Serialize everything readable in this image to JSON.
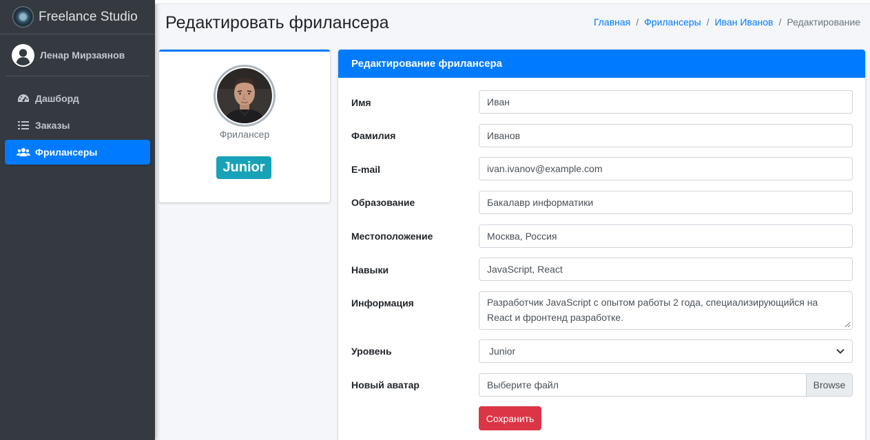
{
  "app": {
    "brand": "Freelance Studio",
    "user_name": "Ленар Мирзаянов"
  },
  "sidebar": {
    "items": [
      {
        "label": "Дашборд",
        "icon": "tachometer-icon",
        "active": false
      },
      {
        "label": "Заказы",
        "icon": "list-icon",
        "active": false
      },
      {
        "label": "Фрилансеры",
        "icon": "users-icon",
        "active": true
      }
    ]
  },
  "header": {
    "title": "Редактировать фрилансера",
    "breadcrumb": [
      "Главная",
      "Фрилансеры",
      "Иван Иванов",
      "Редактирование"
    ]
  },
  "profile": {
    "role": "Фрилансер",
    "level_badge": "Junior"
  },
  "form": {
    "title": "Редактирование фрилансера",
    "fields": {
      "first_name": {
        "label": "Имя",
        "value": "Иван"
      },
      "last_name": {
        "label": "Фамилия",
        "value": "Иванов"
      },
      "email": {
        "label": "E-mail",
        "value": "ivan.ivanov@example.com"
      },
      "education": {
        "label": "Образование",
        "value": "Бакалавр информатики"
      },
      "location": {
        "label": "Местоположение",
        "value": "Москва, Россия"
      },
      "skills": {
        "label": "Навыки",
        "value": "JavaScript, React"
      },
      "info": {
        "label": "Информация",
        "value": "Разработчик JavaScript с опытом работы 2 года, специализирующийся на React и фронтенд разработке."
      },
      "level": {
        "label": "Уровень",
        "value": "Junior"
      },
      "avatar": {
        "label": "Новый аватар",
        "placeholder": "Выберите файл",
        "browse": "Browse"
      }
    },
    "submit_label": "Сохранить"
  },
  "colors": {
    "primary": "#007bff",
    "sidebar_bg": "#343a40",
    "badge": "#17a2b8",
    "danger": "#dc3545"
  }
}
